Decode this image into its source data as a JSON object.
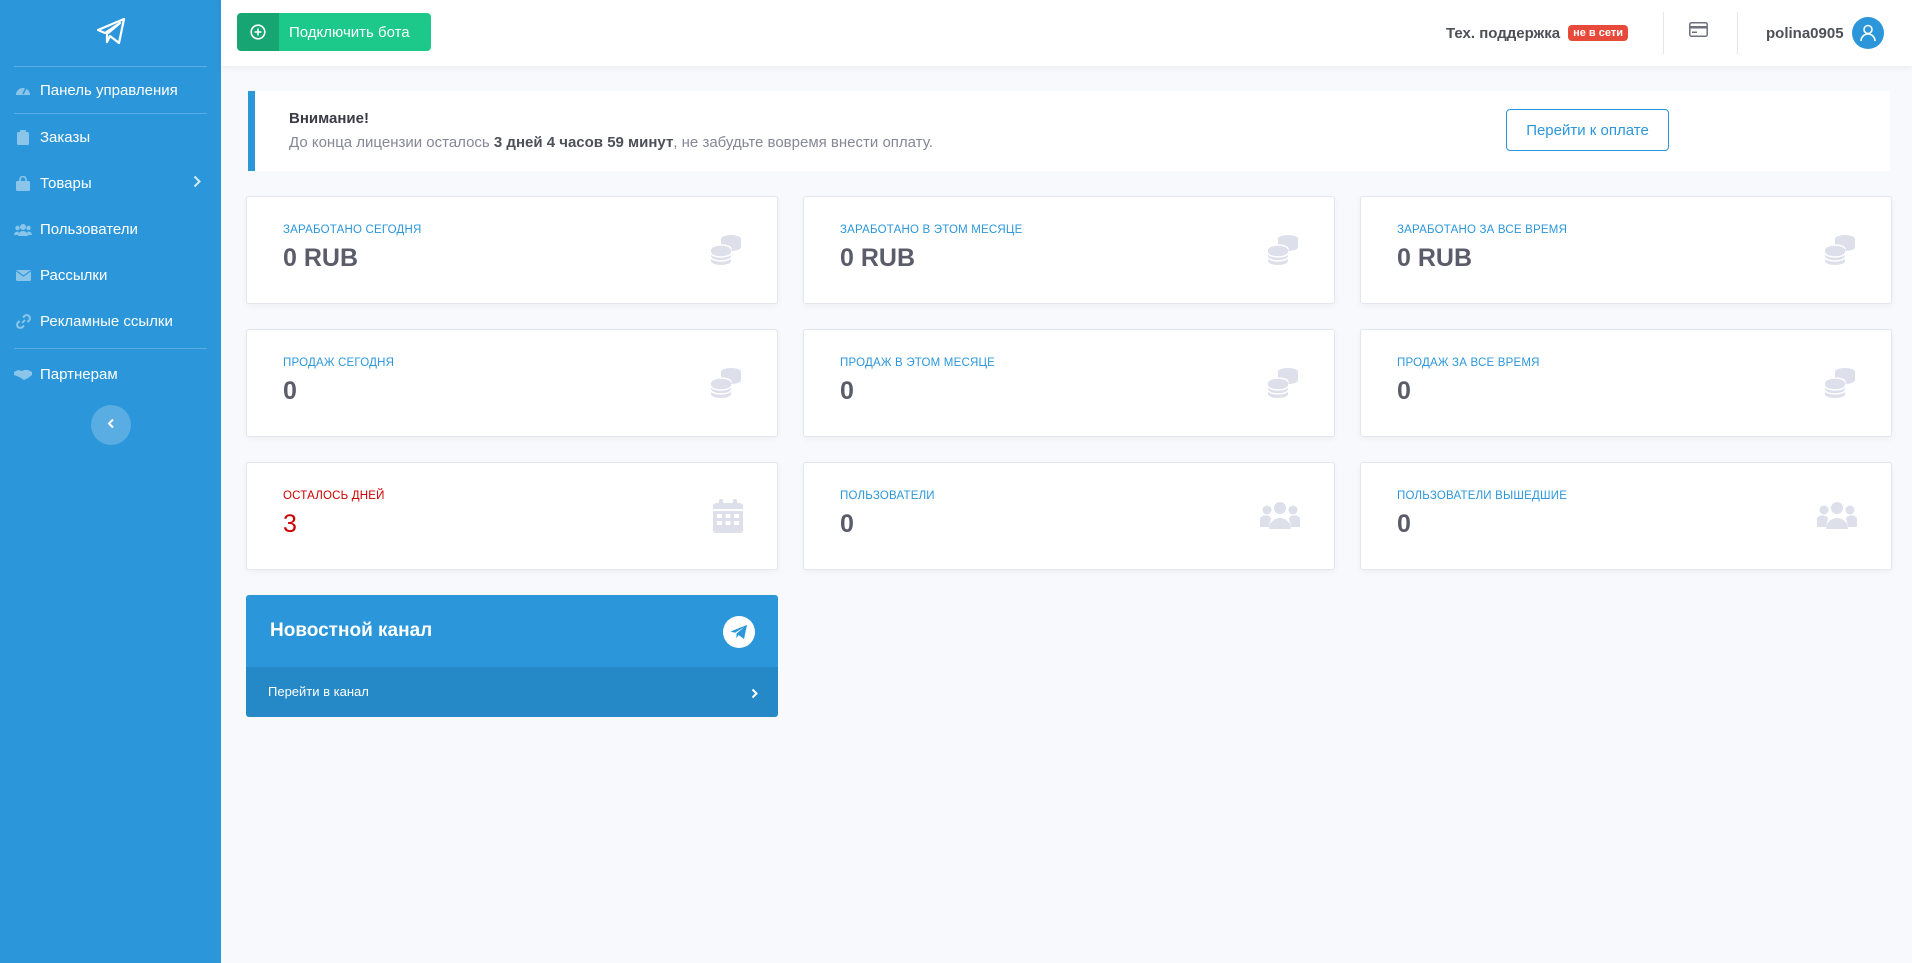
{
  "sidebar": {
    "brand_icon": "telegram-paper-plane-icon",
    "items": [
      {
        "label": "Панель управления",
        "icon": "tachometer-icon"
      },
      {
        "label": "Заказы",
        "icon": "clipboard-icon"
      },
      {
        "label": "Товары",
        "icon": "shopping-bag-icon",
        "has_submenu": true
      },
      {
        "label": "Пользователи",
        "icon": "users-icon"
      },
      {
        "label": "Рассылки",
        "icon": "envelope-icon"
      },
      {
        "label": "Рекламные ссылки",
        "icon": "link-icon"
      },
      {
        "label": "Партнерам",
        "icon": "handshake-icon"
      }
    ],
    "toggle_icon": "chevron-left-icon"
  },
  "topbar": {
    "connect_bot_label": "Подключить бота",
    "support_label": "Тех. поддержка",
    "support_status": "не в сети",
    "username": "polina0905"
  },
  "alert": {
    "title": "Внимание!",
    "text_before": "До конца лицензии осталось ",
    "text_bold": "3 дней 4 часов 59 минут",
    "text_after": ", не забудьте вовремя внести оплату.",
    "pay_button": "Перейти к оплате"
  },
  "stats": [
    {
      "label": "Заработано сегодня",
      "value": "0 RUB",
      "icon": "coins-icon"
    },
    {
      "label": "Заработано в этом месяце",
      "value": "0 RUB",
      "icon": "coins-icon"
    },
    {
      "label": "Заработано за все время",
      "value": "0 RUB",
      "icon": "coins-icon"
    },
    {
      "label": "Продаж сегодня",
      "value": "0",
      "icon": "coins-icon"
    },
    {
      "label": "Продаж в этом месяце",
      "value": "0",
      "icon": "coins-icon"
    },
    {
      "label": "Продаж за все время",
      "value": "0",
      "icon": "coins-icon"
    },
    {
      "label": "Осталось дней",
      "value": "3",
      "icon": "calendar-icon",
      "status": "danger"
    },
    {
      "label": "Пользователи",
      "value": "0",
      "icon": "users-icon"
    },
    {
      "label": "Пользователи вышедшие",
      "value": "0",
      "icon": "users-icon"
    }
  ],
  "news": {
    "title": "Новостной канал",
    "link_label": "Перейти в канал"
  },
  "colors": {
    "primary": "#2b97da",
    "success": "#1cc88a",
    "danger": "#cc0000",
    "badge": "#e74a3b"
  }
}
